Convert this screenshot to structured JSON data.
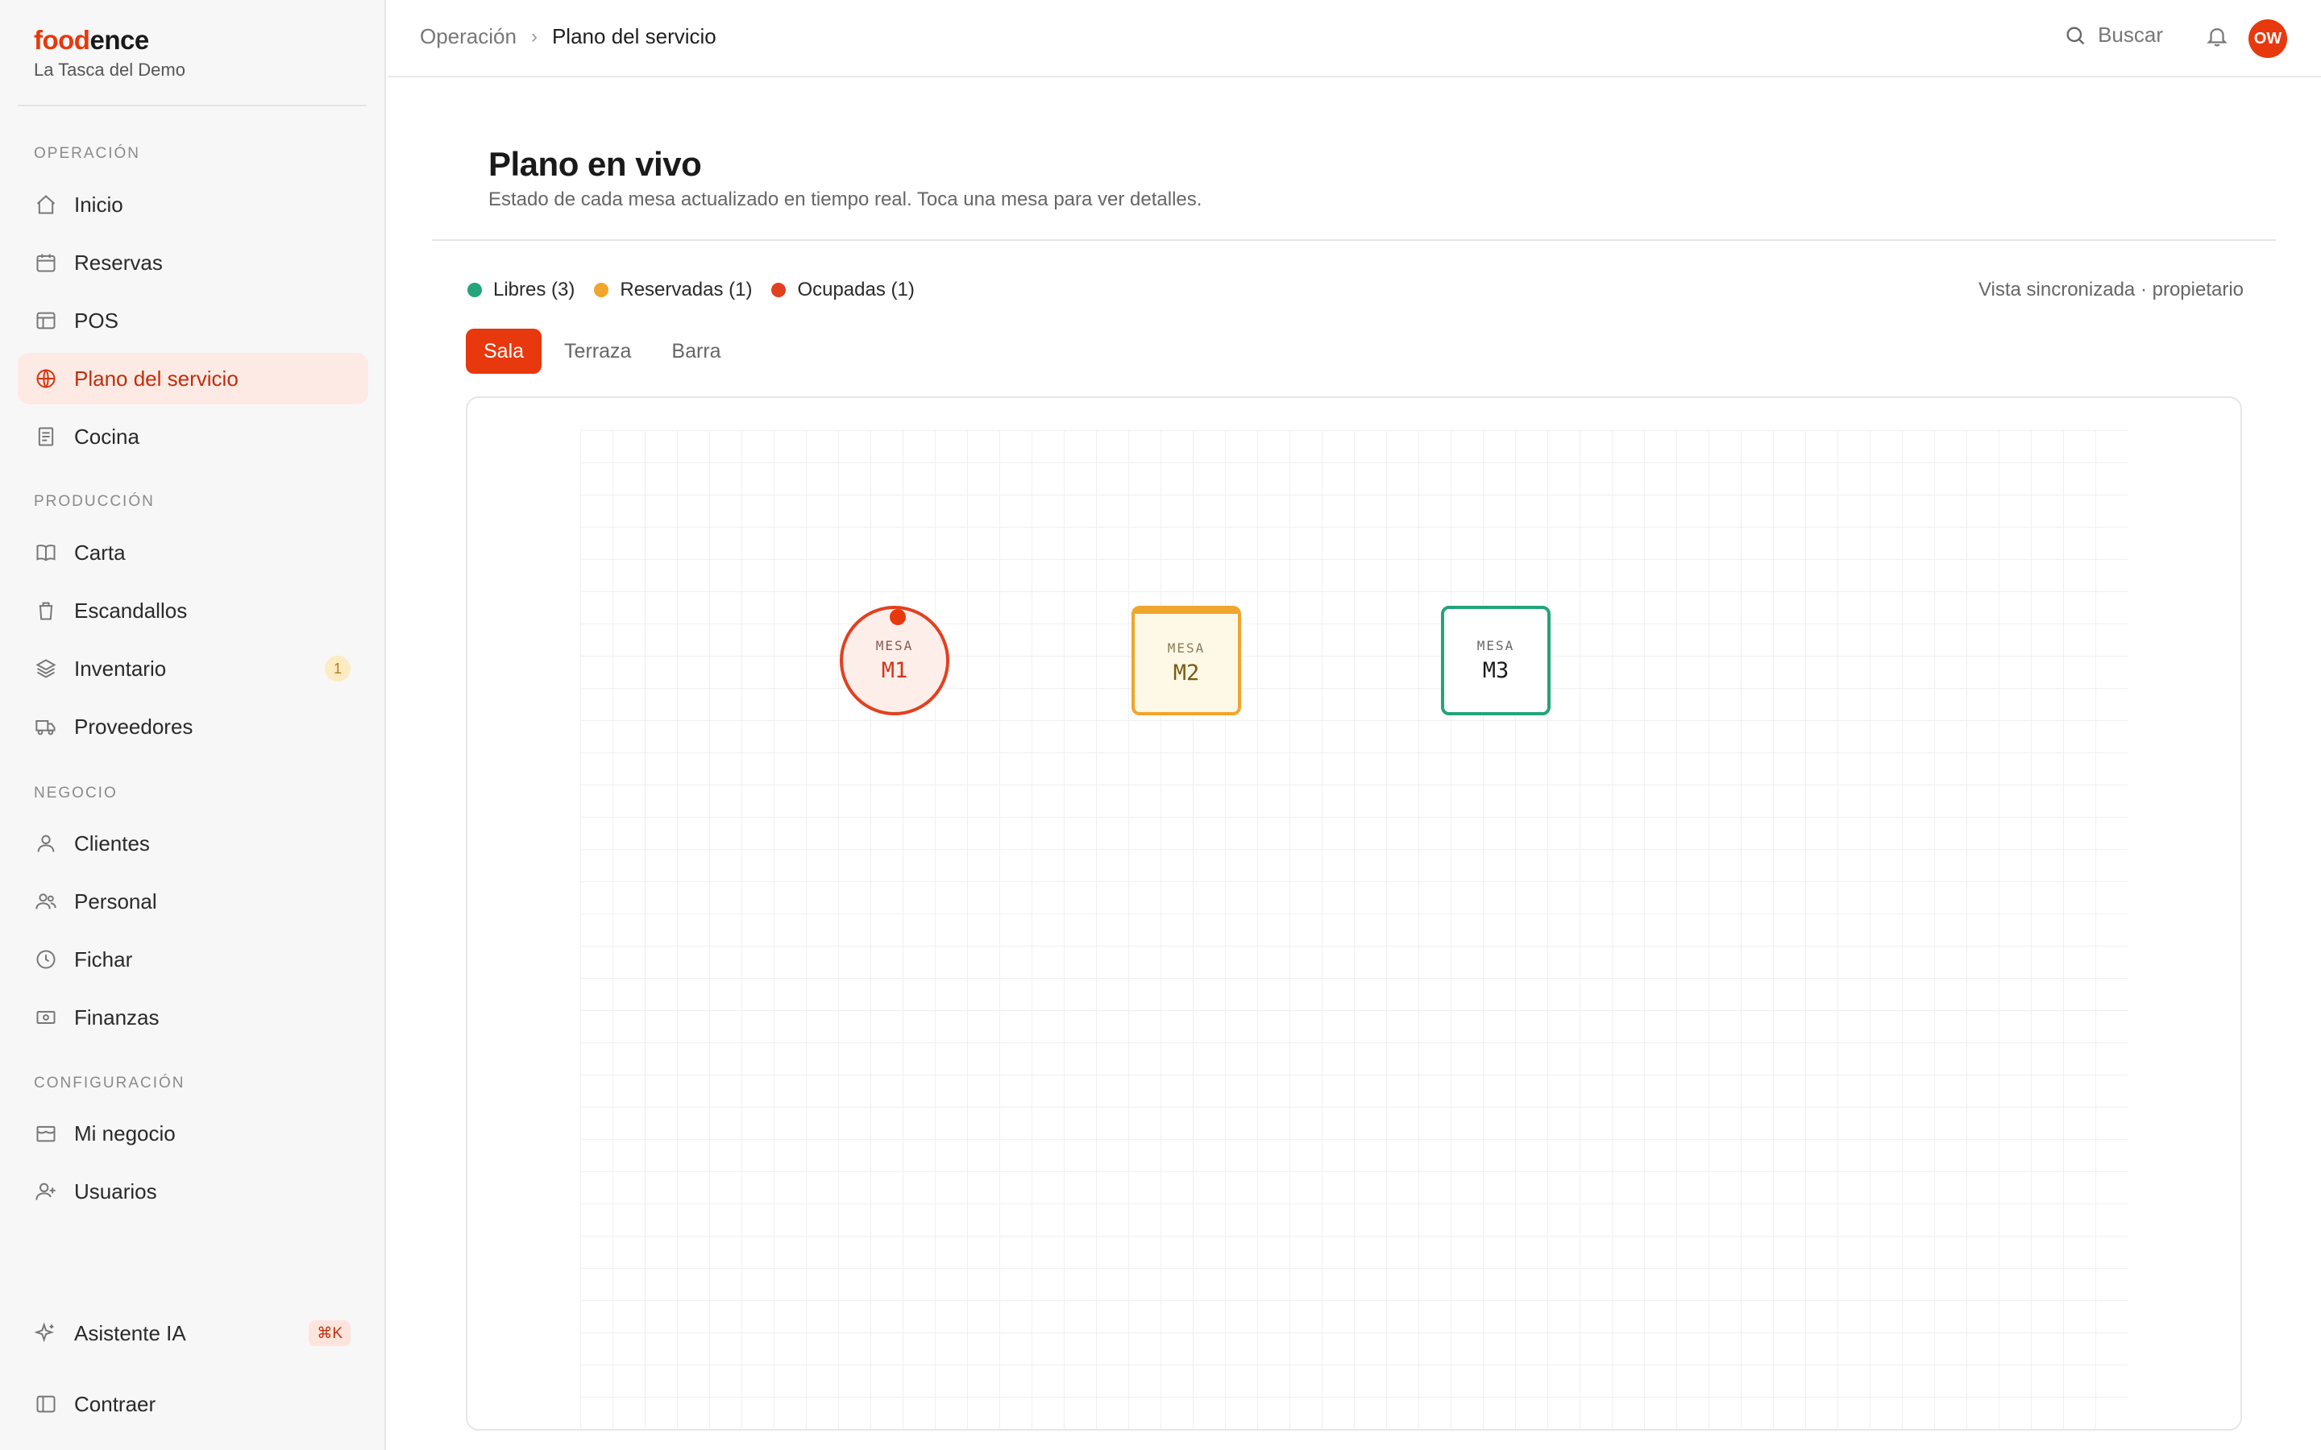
{
  "brand": {
    "name_part1": "food",
    "name_part2": "ence",
    "org": "La Tasca del Demo"
  },
  "sidebar": {
    "sections": {
      "operacion": "OPERACIÓN",
      "produccion": "PRODUCCIÓN",
      "negocio": "NEGOCIO",
      "configuracion": "CONFIGURACIÓN"
    },
    "items": {
      "inicio": "Inicio",
      "reservas": "Reservas",
      "pos": "POS",
      "plano": "Plano del servicio",
      "cocina": "Cocina",
      "carta": "Carta",
      "escandallos": "Escandallos",
      "inventario": "Inventario",
      "inventario_badge": "1",
      "proveedores": "Proveedores",
      "clientes": "Clientes",
      "personal": "Personal",
      "fichar": "Fichar",
      "finanzas": "Finanzas",
      "mi_negocio": "Mi negocio",
      "usuarios": "Usuarios",
      "asistente": "Asistente IA",
      "asistente_kbd": "⌘K",
      "contraer": "Contraer"
    }
  },
  "topbar": {
    "breadcrumb_parent": "Operación",
    "breadcrumb_sep": "›",
    "breadcrumb_current": "Plano del servicio",
    "search_label": "Buscar",
    "avatar_initials": "OW"
  },
  "main": {
    "title": "Plano en vivo",
    "subtitle": "Estado de cada mesa actualizado en tiempo real. Toca una mesa para ver detalles.",
    "legend": {
      "libres": "Libres (3)",
      "reservadas": "Reservadas (1)",
      "ocupadas": "Ocupadas (1)"
    },
    "sync_status": "Vista sincronizada · propietario",
    "tabs": [
      "Sala",
      "Terraza",
      "Barra"
    ],
    "tables": [
      {
        "label": "MESA",
        "name": "M1",
        "status": "ocupada"
      },
      {
        "label": "MESA",
        "name": "M2",
        "status": "reservada"
      },
      {
        "label": "MESA",
        "name": "M3",
        "status": "libre"
      }
    ]
  },
  "colors": {
    "accent": "#e8380d",
    "libre": "#23a47a",
    "reservada": "#f0a52c",
    "ocupada": "#e2401f"
  }
}
